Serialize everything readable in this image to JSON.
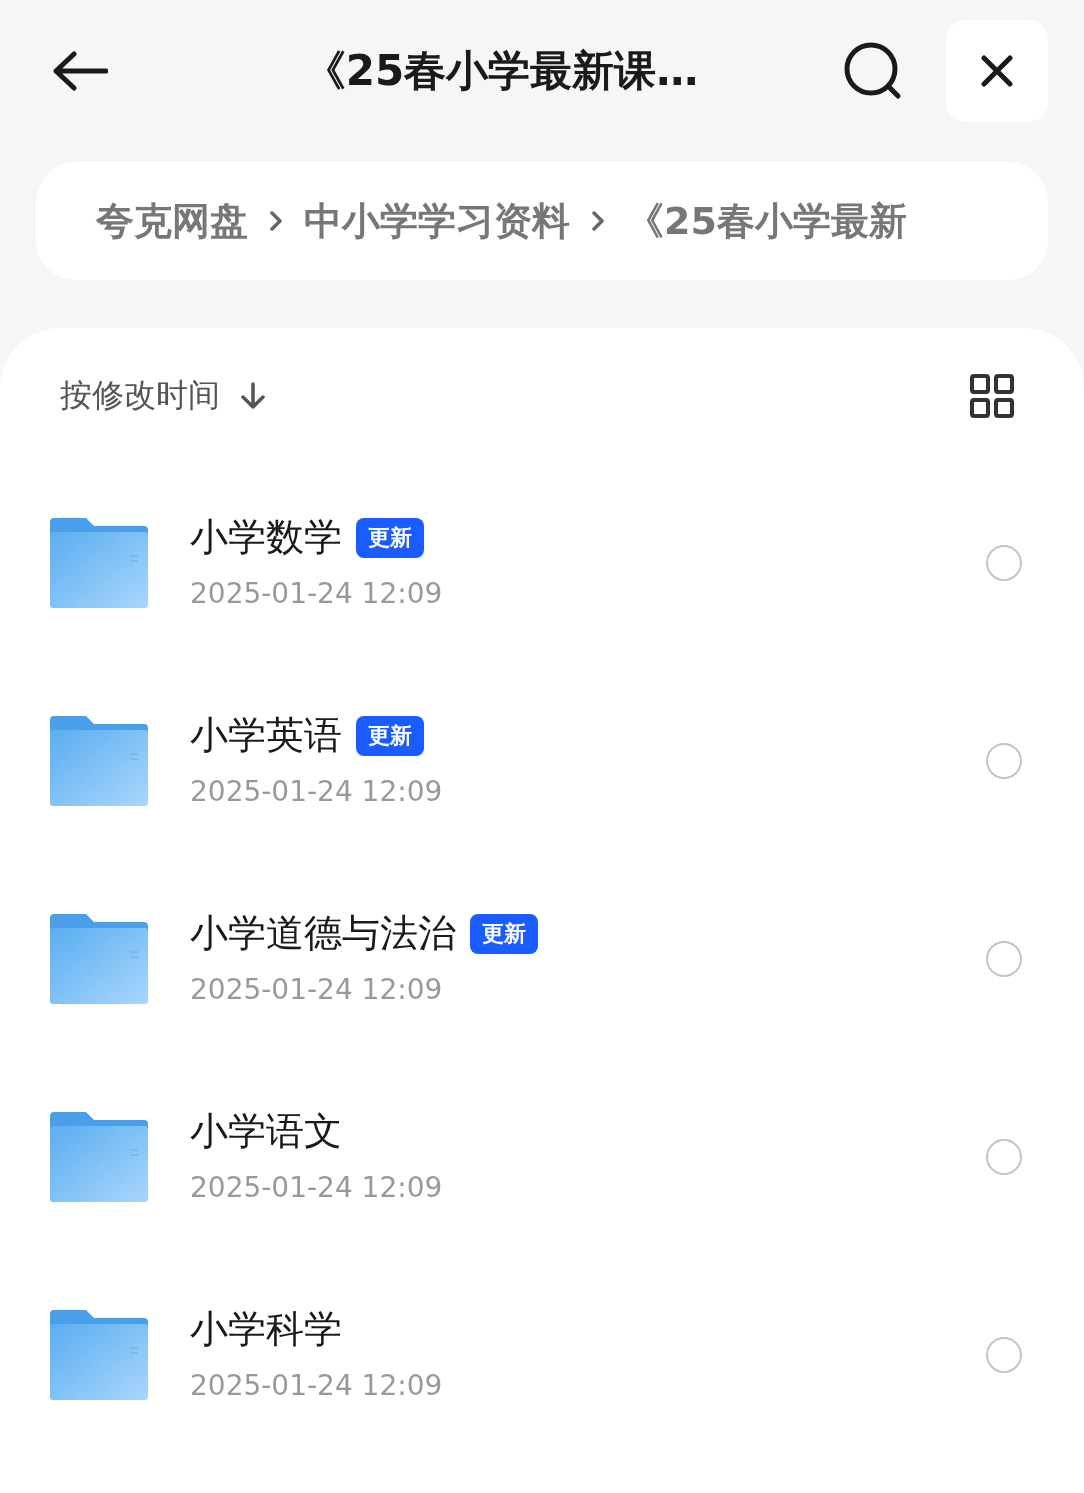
{
  "header": {
    "title": "《25春小学最新课…"
  },
  "breadcrumb": [
    "夸克网盘",
    "中小学学习资料",
    "《25春小学最新"
  ],
  "sort": {
    "label": "按修改时间"
  },
  "files": [
    {
      "name": "小学数学",
      "badge": "更新",
      "date": "2025-01-24 12:09",
      "selected": false
    },
    {
      "name": "小学英语",
      "badge": "更新",
      "date": "2025-01-24 12:09",
      "selected": false
    },
    {
      "name": "小学道德与法治",
      "badge": "更新",
      "date": "2025-01-24 12:09",
      "selected": false
    },
    {
      "name": "小学语文",
      "date": "2025-01-24 12:09",
      "selected": false
    },
    {
      "name": "小学科学",
      "date": "2025-01-24 12:09",
      "selected": false
    }
  ]
}
